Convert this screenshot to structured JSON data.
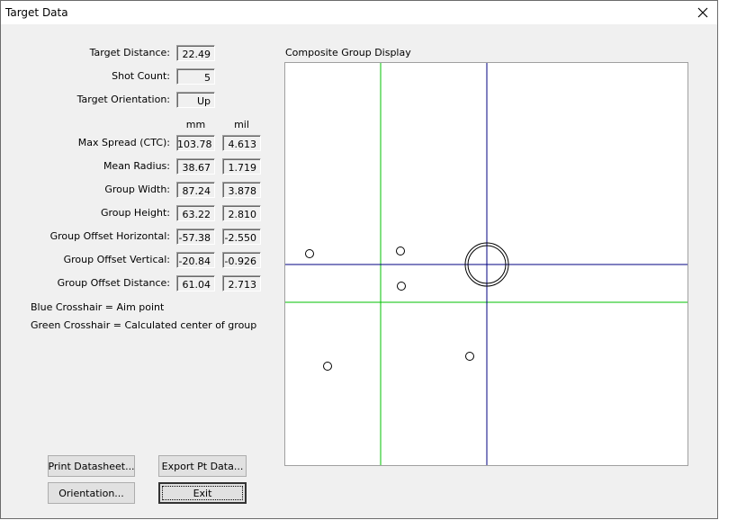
{
  "window": {
    "title": "Target Data"
  },
  "summary": {
    "target_distance": {
      "label": "Target Distance:",
      "value": "22.49"
    },
    "shot_count": {
      "label": "Shot Count:",
      "value": "5"
    },
    "target_orientation": {
      "label": "Target Orientation:",
      "value": "Up"
    }
  },
  "stats": {
    "col_mm": "mm",
    "col_mil": "mil",
    "rows": [
      {
        "label": "Max Spread (CTC):",
        "mm": "103.78",
        "mil": "4.613"
      },
      {
        "label": "Mean Radius:",
        "mm": "38.67",
        "mil": "1.719"
      },
      {
        "label": "Group Width:",
        "mm": "87.24",
        "mil": "3.878"
      },
      {
        "label": "Group Height:",
        "mm": "63.22",
        "mil": "2.810"
      },
      {
        "label": "Group Offset Horizontal:",
        "mm": "-57.38",
        "mil": "-2.550"
      },
      {
        "label": "Group Offset Vertical:",
        "mm": "-20.84",
        "mil": "-0.926"
      },
      {
        "label": "Group Offset Distance:",
        "mm": "61.04",
        "mil": "2.713"
      }
    ]
  },
  "legend": {
    "blue": "Blue Crosshair = Aim point",
    "green": "Green Crosshair = Calculated center of group"
  },
  "buttons": {
    "print": "Print Datasheet...",
    "export": "Export Pt Data...",
    "orientation": "Orientation...",
    "exit": "Exit"
  },
  "display": {
    "title": "Composite Group Display",
    "colors": {
      "aim": "#000080",
      "center": "#00c000",
      "shot": "#000000",
      "aim_circle": "#000000"
    }
  }
}
